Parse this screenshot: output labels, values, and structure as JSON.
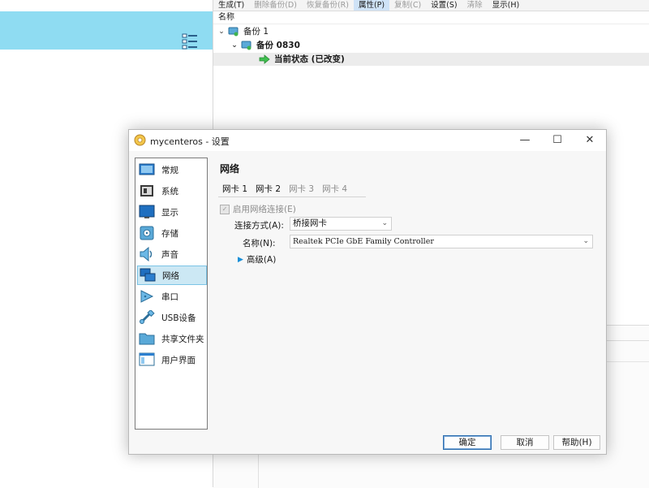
{
  "toolbar": {
    "items": [
      {
        "label": "生成(T)",
        "state": "normal"
      },
      {
        "label": "删除备份(D)",
        "state": "disabled"
      },
      {
        "label": "恢复备份(R)",
        "state": "disabled"
      },
      {
        "label": "属性(P)",
        "state": "active"
      },
      {
        "label": "复制(C)",
        "state": "disabled"
      },
      {
        "label": "设置(S)",
        "state": "normal"
      },
      {
        "label": "清除",
        "state": "disabled"
      },
      {
        "label": "显示(H)",
        "state": "normal"
      }
    ]
  },
  "snapshots": {
    "column_header": "名称",
    "rows": [
      {
        "label": "备份 1",
        "bold": false
      },
      {
        "label": "备份 0830",
        "bold": true
      },
      {
        "label": "当前状态 (已改变)",
        "bold": true
      }
    ]
  },
  "dialog": {
    "title": "mycenteros - 设置",
    "window_controls": {
      "minimize": "—",
      "maximize": "☐",
      "close": "✕"
    },
    "categories": [
      {
        "label": "常规",
        "icon": "general-icon"
      },
      {
        "label": "系统",
        "icon": "system-icon"
      },
      {
        "label": "显示",
        "icon": "display-icon"
      },
      {
        "label": "存储",
        "icon": "storage-icon"
      },
      {
        "label": "声音",
        "icon": "audio-icon"
      },
      {
        "label": "网络",
        "icon": "network-icon",
        "selected": true
      },
      {
        "label": "串口",
        "icon": "serial-port-icon"
      },
      {
        "label": "USB设备",
        "icon": "usb-icon"
      },
      {
        "label": "共享文件夹",
        "icon": "shared-folder-icon"
      },
      {
        "label": "用户界面",
        "icon": "user-interface-icon"
      }
    ],
    "section_title": "网络",
    "tabs": [
      {
        "label": "网卡 1",
        "active": true
      },
      {
        "label": "网卡 2",
        "active": true
      },
      {
        "label": "网卡 3",
        "active": false
      },
      {
        "label": "网卡 4",
        "active": false
      }
    ],
    "enable_adapter": {
      "label": "启用网络连接(E)",
      "checked": true,
      "disabled": true
    },
    "attached_to": {
      "label": "连接方式(A):",
      "value": "桥接网卡"
    },
    "adapter_name": {
      "label": "名称(N):",
      "value": "Realtek PCIe GbE Family Controller"
    },
    "advanced": {
      "label": "高级(A)"
    },
    "buttons": {
      "ok": "确定",
      "cancel": "取消",
      "help": "帮助(H)"
    }
  },
  "colors": {
    "header_accent": "#8fdcf2",
    "selection": "#cce8f4",
    "selection_border": "#7cc4e6",
    "default_button_border": "#2f6fb0",
    "expand_arrow": "#1a8fd8"
  }
}
